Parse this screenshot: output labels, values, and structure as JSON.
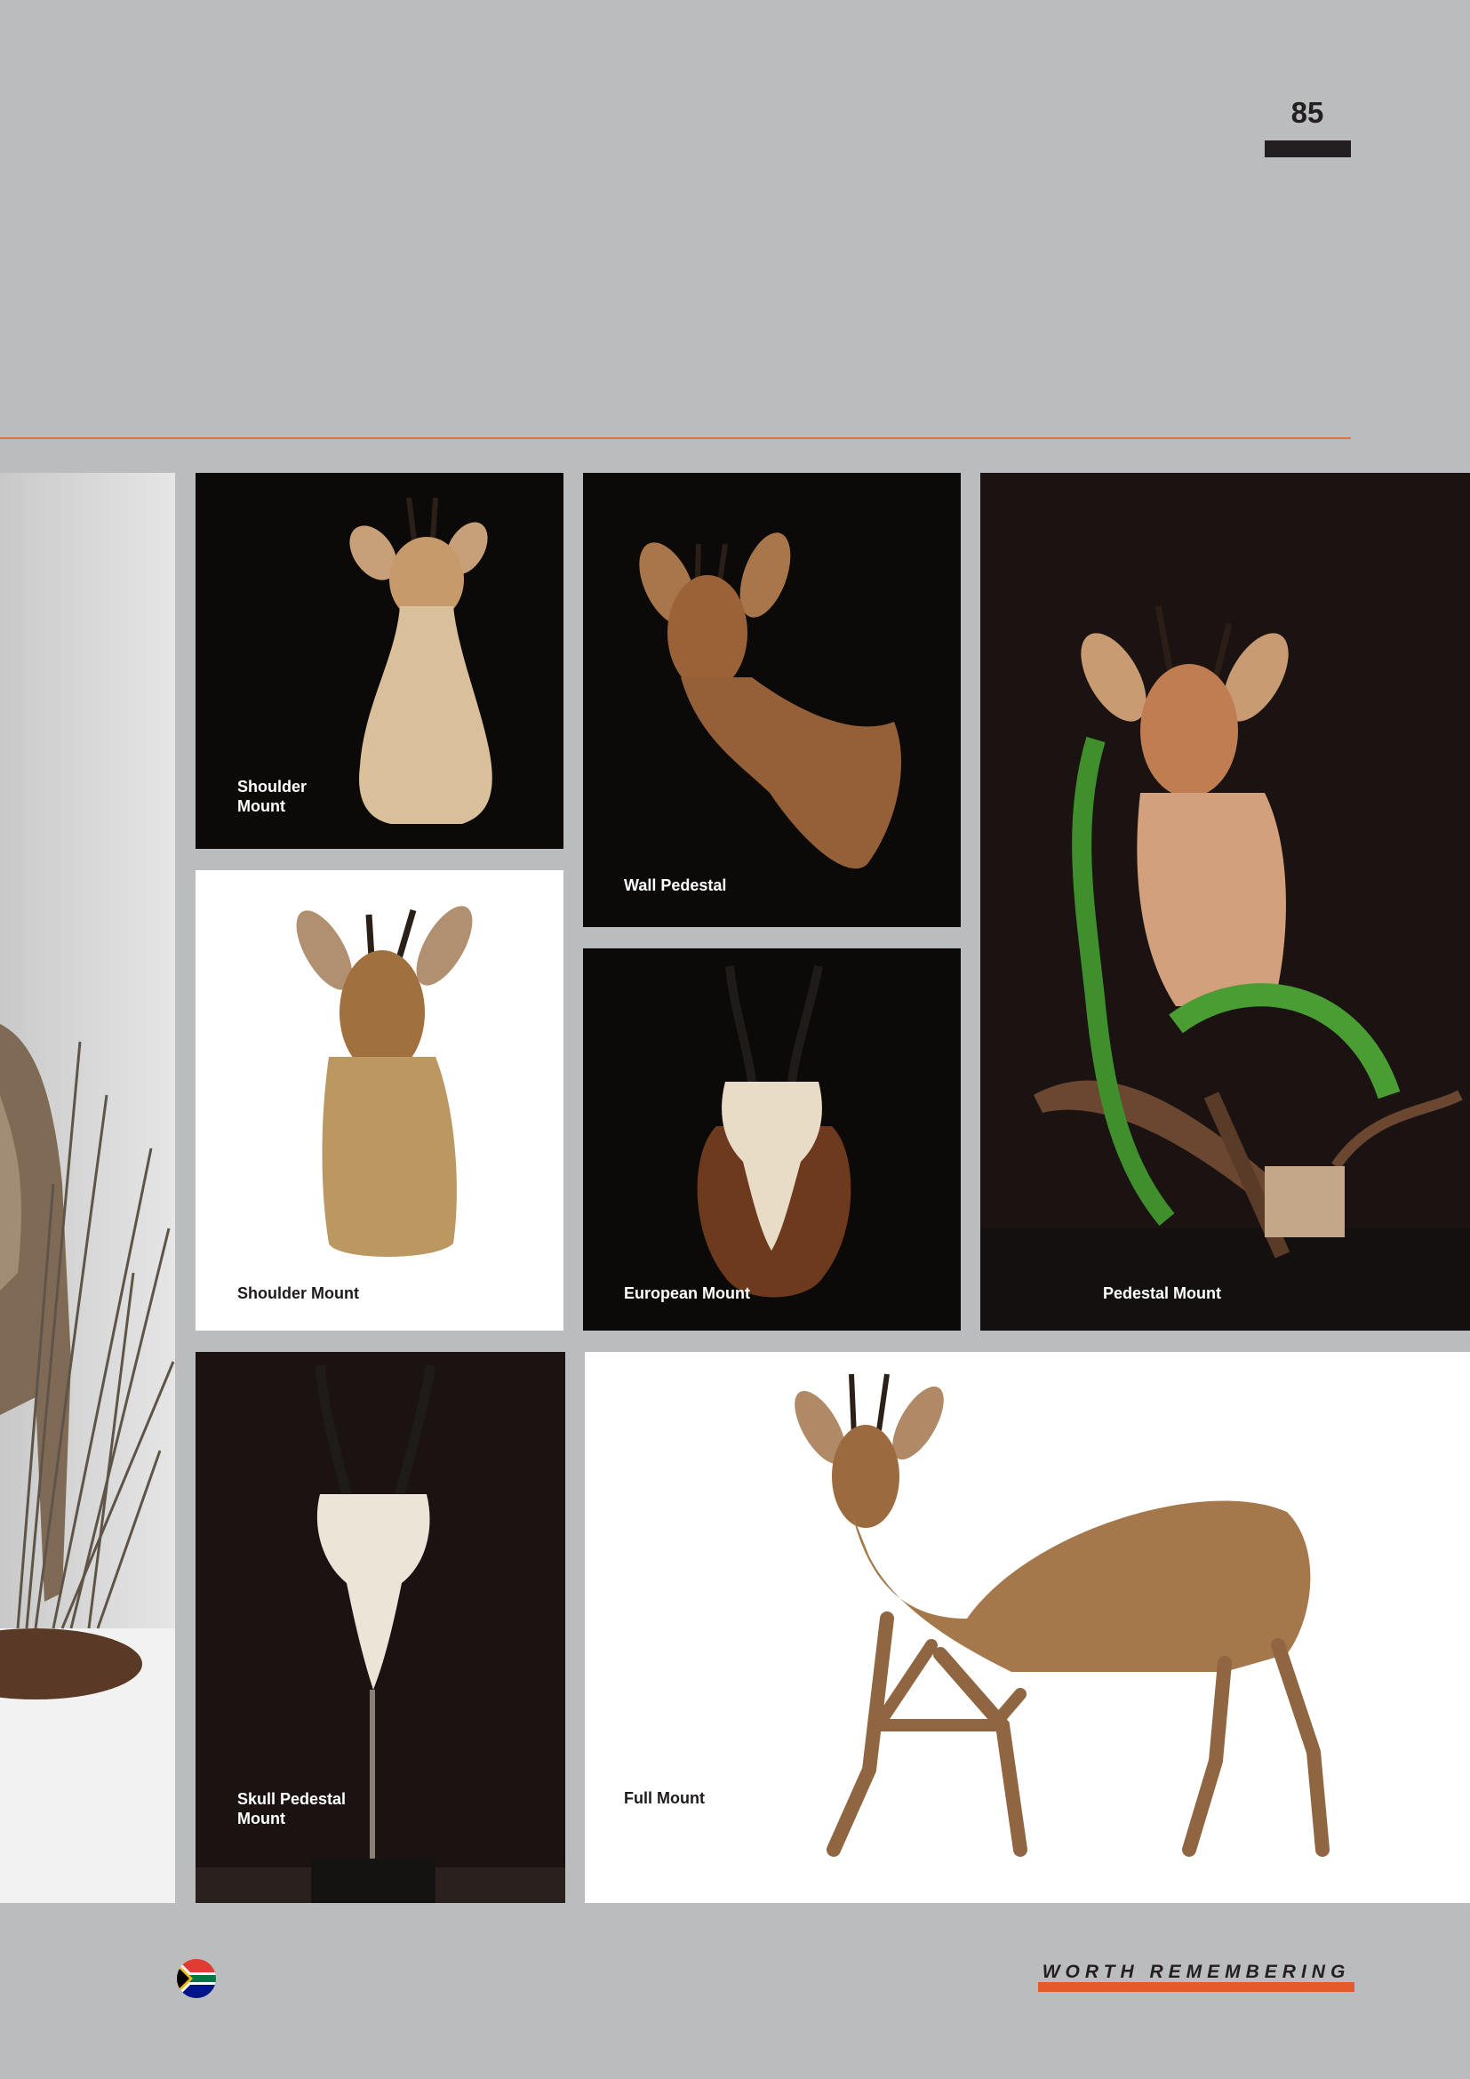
{
  "page": {
    "number": "85",
    "tagline": "WORTH REMEMBERING",
    "accent_color": "#e0703f",
    "tagline_bar_color": "#e55a2b"
  },
  "photos": [
    {
      "id": "left-edge",
      "caption": "",
      "subject": "full mount grysbok with grass (cropped)"
    },
    {
      "id": "shoulder-dark",
      "caption": "Shoulder\nMount"
    },
    {
      "id": "wall-pedestal",
      "caption": "Wall Pedestal"
    },
    {
      "id": "pedestal",
      "caption": "Pedestal Mount"
    },
    {
      "id": "shoulder-white",
      "caption": "Shoulder Mount"
    },
    {
      "id": "european",
      "caption": "European Mount"
    },
    {
      "id": "skull-pedestal",
      "caption": "Skull Pedestal\nMount"
    },
    {
      "id": "full-mount",
      "caption": "Full Mount"
    }
  ],
  "footer": {
    "flag_icon": "south-africa-flag-icon"
  }
}
